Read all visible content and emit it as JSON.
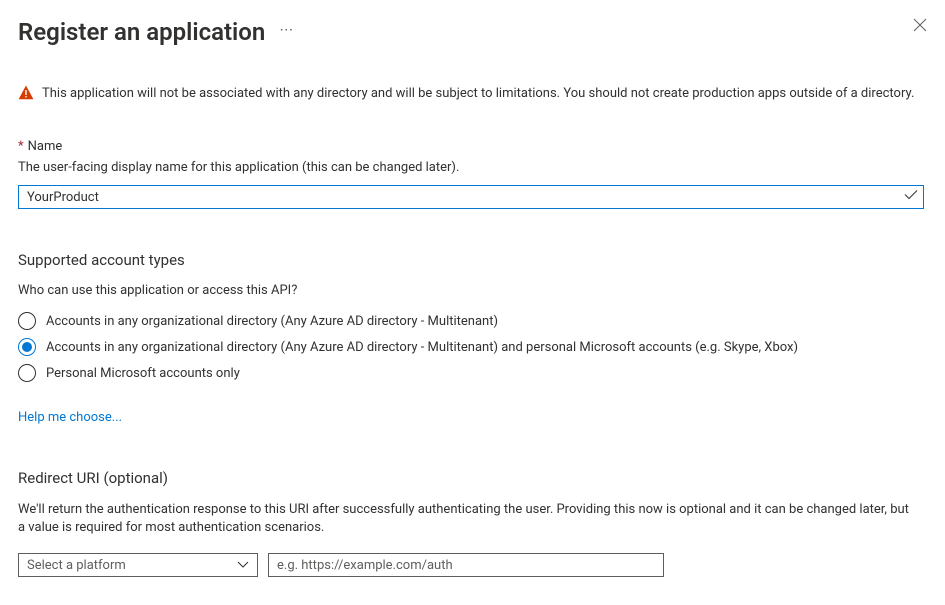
{
  "header": {
    "title": "Register an application"
  },
  "warning": {
    "text": "This application will not be associated with any directory and will be subject to limitations. You should not create production apps outside of a directory."
  },
  "name_section": {
    "label": "Name",
    "hint": "The user-facing display name for this application (this can be changed later).",
    "value": "YourProduct"
  },
  "account_types": {
    "heading": "Supported account types",
    "subheading": "Who can use this application or access this API?",
    "options": [
      {
        "label": "Accounts in any organizational directory (Any Azure AD directory - Multitenant)"
      },
      {
        "label": "Accounts in any organizational directory (Any Azure AD directory - Multitenant) and personal Microsoft accounts (e.g. Skype, Xbox)"
      },
      {
        "label": "Personal Microsoft accounts only"
      }
    ],
    "selected_index": 1,
    "help_link": "Help me choose..."
  },
  "redirect": {
    "heading": "Redirect URI (optional)",
    "description": "We'll return the authentication response to this URI after successfully authenticating the user. Providing this now is optional and it can be changed later, but a value is required for most authentication scenarios.",
    "platform_placeholder": "Select a platform",
    "uri_placeholder": "e.g. https://example.com/auth"
  }
}
